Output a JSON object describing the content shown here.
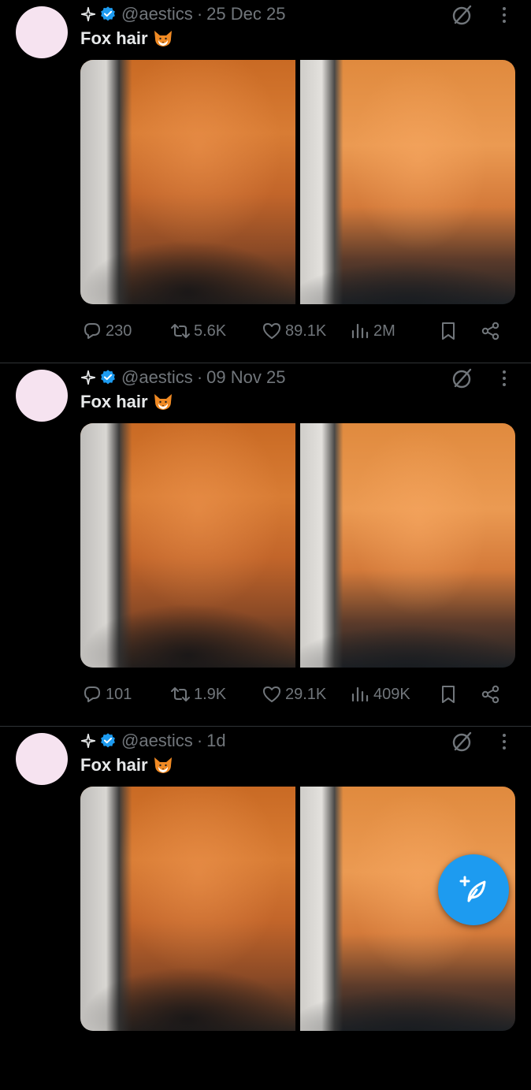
{
  "colors": {
    "background": "#000000",
    "text_primary": "#e7e9ea",
    "text_secondary": "#71767b",
    "verified_badge": "#1d9bf0",
    "compose_button": "#1d9bf0",
    "avatar": "#f6e3f0"
  },
  "icons": {
    "header": [
      "sparkle-icon",
      "verified-badge-icon",
      "grok-icon",
      "more-vertical-icon"
    ],
    "actions": [
      "reply-icon",
      "retweet-icon",
      "heart-icon",
      "views-icon",
      "bookmark-icon",
      "share-icon"
    ],
    "fab": "compose-post-icon"
  },
  "tweets": [
    {
      "handle": "@aestics",
      "separator": "·",
      "time": "25 Dec 25",
      "text": "Fox hair",
      "replies": "230",
      "retweets": "5.6K",
      "likes": "89.1K",
      "views": "2M"
    },
    {
      "handle": "@aestics",
      "separator": "·",
      "time": "09 Nov 25",
      "text": "Fox hair",
      "replies": "101",
      "retweets": "1.9K",
      "likes": "29.1K",
      "views": "409K"
    },
    {
      "handle": "@aestics",
      "separator": "·",
      "time": "1d",
      "text": "Fox hair"
    }
  ]
}
